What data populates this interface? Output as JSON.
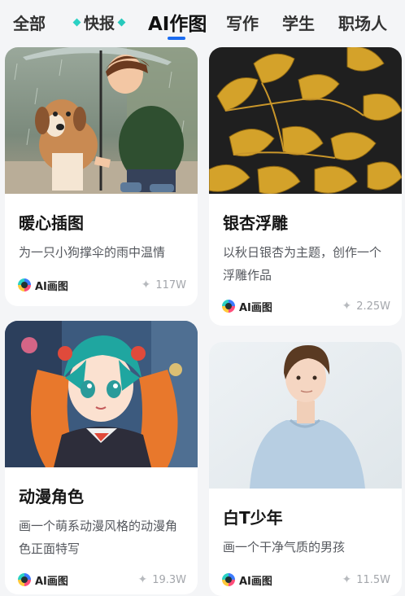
{
  "tabs": {
    "all": "全部",
    "quick": "快报",
    "ai_draw": "AI作图",
    "write": "写作",
    "student": "学生",
    "work": "职场人"
  },
  "colors": {
    "accent": "#1c6cf0",
    "quick_diamond": "#2ad1c4"
  },
  "cards": [
    {
      "title": "暖心插图",
      "desc": "为一只小狗撑伞的雨中温情",
      "source": "AI画图",
      "count": "117W",
      "image": "boy-umbrella-dog"
    },
    {
      "title": "银杏浮雕",
      "desc": "以秋日银杏为主题，创作一个浮雕作品",
      "source": "AI画图",
      "count": "2.25W",
      "image": "golden-ginkgo-leaves"
    },
    {
      "title": "动漫角色",
      "desc": "画一个萌系动漫风格的动漫角色正面特写",
      "source": "AI画图",
      "count": "19.3W",
      "image": "anime-girl-portrait"
    },
    {
      "title": "白T少年",
      "desc": "画一个干净气质的男孩",
      "source": "AI画图",
      "count": "11.5W",
      "image": "boy-white-tshirt"
    }
  ]
}
